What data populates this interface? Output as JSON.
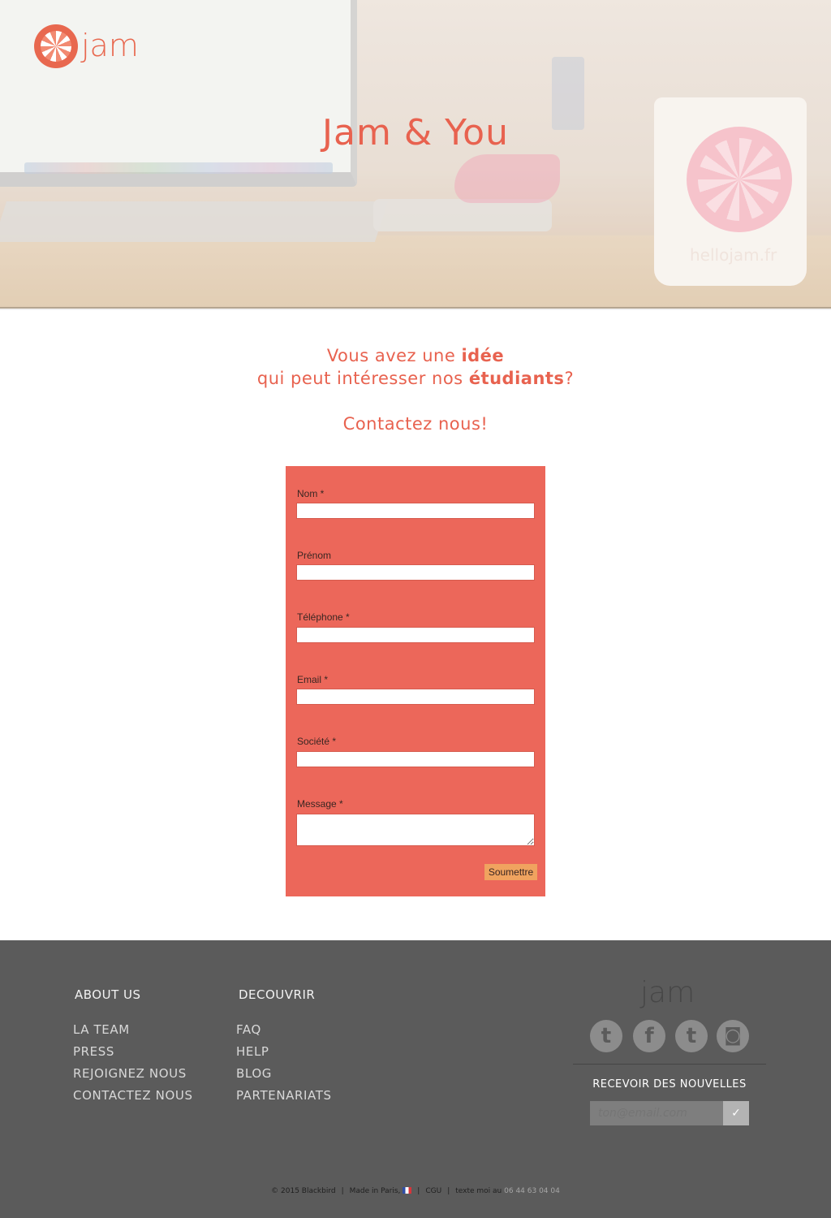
{
  "brand": {
    "logo_text": "jam"
  },
  "hero": {
    "title": "Jam & You",
    "mug_text": "hellojam.fr"
  },
  "intro": {
    "line1_pre": "Vous avez une ",
    "line1_bold": "idée",
    "line2_pre": "qui peut intéresser nos ",
    "line2_bold": "étudiants",
    "line2_post": "?",
    "contact": "Contactez nous!"
  },
  "form": {
    "fields": [
      {
        "label": "Nom *",
        "value": ""
      },
      {
        "label": "Prénom",
        "value": ""
      },
      {
        "label": "Téléphone *",
        "value": ""
      },
      {
        "label": "Email *",
        "value": ""
      },
      {
        "label": "Société *",
        "value": ""
      },
      {
        "label": "Message *",
        "value": ""
      }
    ],
    "submit_label": "Soumettre"
  },
  "footer": {
    "col1": {
      "heading": "ABOUT US",
      "links": [
        "LA TEAM",
        "PRESS",
        "REJOIGNEZ NOUS",
        "CONTACTEZ NOUS"
      ]
    },
    "col2": {
      "heading": "DECOUVRIR",
      "links": [
        "FAQ",
        "HELP",
        "BLOG",
        "PARTENARIATS"
      ]
    },
    "logo_text": "jam",
    "social": [
      {
        "icon": "twitter-icon",
        "glyph": "t"
      },
      {
        "icon": "facebook-icon",
        "glyph": "f"
      },
      {
        "icon": "tumblr-icon",
        "glyph": "t"
      },
      {
        "icon": "instagram-icon",
        "glyph": "◙"
      }
    ],
    "newsletter": {
      "title": "RECEVOIR DES NOUVELLES",
      "placeholder": "ton@email.com",
      "button_icon": "checkmark-icon",
      "button_glyph": "✓"
    },
    "copyright": {
      "text": "© 2015 Blackbird",
      "made_in": "Made in Paris,",
      "cgu": "CGU",
      "text_me": "texte moi au",
      "phone": "06 44 63 04 04"
    }
  },
  "colors": {
    "accent": "#e8624f",
    "form_bg": "#ec675a",
    "footer_bg": "#5b5b5b",
    "submit_bg": "#f0a35f"
  }
}
